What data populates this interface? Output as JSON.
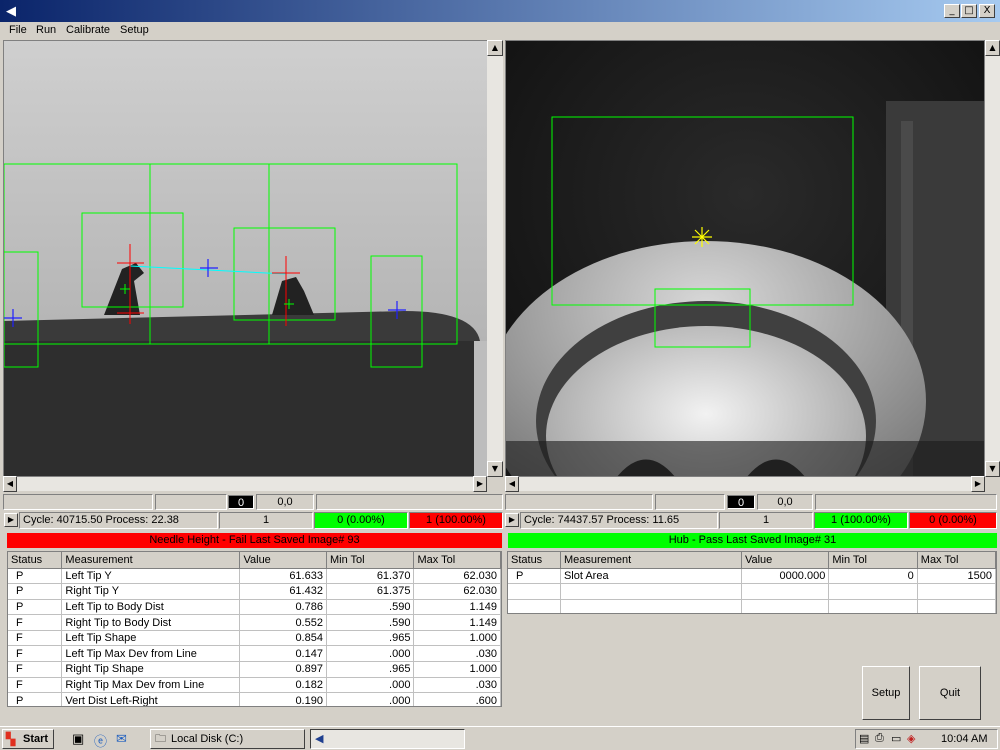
{
  "menu": [
    "File",
    "Run",
    "Calibrate",
    "Setup"
  ],
  "window_buttons": {
    "minimize": "_",
    "restore": "□",
    "close": "X"
  },
  "left": {
    "counter": "0",
    "coords": "0,0",
    "cycle_text": "Cycle: 40715.50 Process:  22.38",
    "count": "1",
    "pass_text": "0 (0.00%)",
    "fail_text": "1 (100.00%)",
    "banner": "Needle Height - Fail      Last Saved Image# 93",
    "banner_color": "#ff0000",
    "columns": [
      "Status",
      "Measurement",
      "Value",
      "Min Tol",
      "Max Tol"
    ],
    "rows": [
      [
        "P",
        "Left Tip Y",
        "61.633",
        "61.370",
        "62.030"
      ],
      [
        "P",
        "Right Tip Y",
        "61.432",
        "61.375",
        "62.030"
      ],
      [
        "P",
        "Left Tip to Body Dist",
        "0.786",
        ".590",
        "1.149"
      ],
      [
        "F",
        "Right Tip to Body Dist",
        "0.552",
        ".590",
        "1.149"
      ],
      [
        "F",
        "Left Tip Shape",
        "0.854",
        ".965",
        "1.000"
      ],
      [
        "F",
        "Left Tip Max Dev from Line",
        "0.147",
        ".000",
        ".030"
      ],
      [
        "F",
        "Right Tip Shape",
        "0.897",
        ".965",
        "1.000"
      ],
      [
        "F",
        "Right Tip Max Dev from Line",
        "0.182",
        ".000",
        ".030"
      ],
      [
        "P",
        "Vert Dist Left-Right",
        "0.190",
        ".000",
        ".600"
      ]
    ]
  },
  "right": {
    "counter": "0",
    "coords": "0,0",
    "cycle_text": "Cycle: 74437.57 Process:  11.65",
    "count": "1",
    "pass_text": "1 (100.00%)",
    "fail_text": "0 (0.00%)",
    "banner": "Hub - Pass      Last Saved Image# 31",
    "banner_color": "#00ff00",
    "columns": [
      "Status",
      "Measurement",
      "Value",
      "Min Tol",
      "Max Tol"
    ],
    "rows": [
      [
        "P",
        "Slot Area",
        "0000.000",
        "0",
        "1500"
      ],
      [
        "",
        "",
        "",
        "",
        ""
      ],
      [
        "",
        "",
        "",
        "",
        ""
      ]
    ]
  },
  "buttons": {
    "setup": "Setup",
    "quit": "Quit"
  },
  "taskbar": {
    "start": "Start",
    "task": "Local Disk (C:)",
    "clock": "10:04 AM"
  },
  "colors": {
    "pass": "#00ff00",
    "fail": "#ff0000",
    "overlay": "#00ff00",
    "titlebar": "#0a246a"
  }
}
